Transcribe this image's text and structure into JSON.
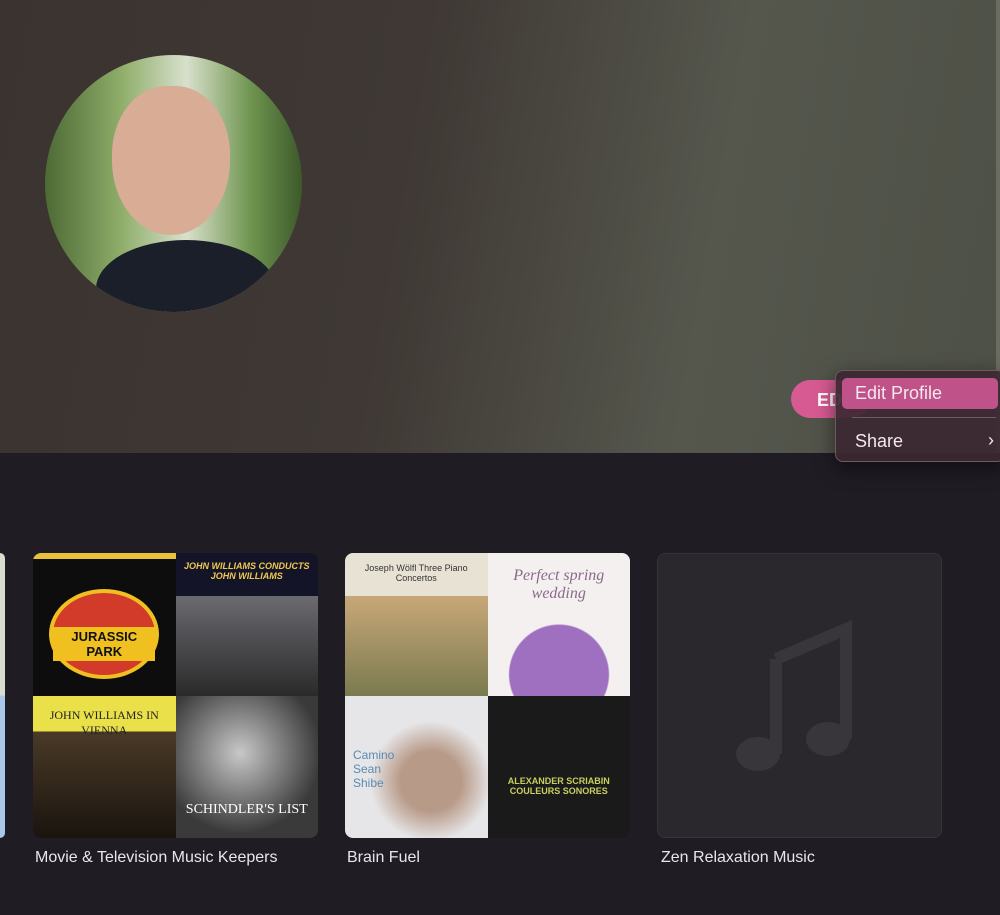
{
  "profile": {
    "edit_button_label": "EDIT"
  },
  "context_menu": {
    "items": [
      {
        "label": "Edit Profile"
      },
      {
        "label": "Share",
        "submenu_icon": "chevron-right"
      }
    ]
  },
  "playlists": [
    {
      "title": "Movie & Television Music Keepers",
      "covers": [
        "JURASSIC PARK",
        "JOHN WILLIAMS CONDUCTS JOHN WILLIAMS",
        "JOHN WILLIAMS IN VIENNA",
        "SCHINDLER'S LIST"
      ]
    },
    {
      "title": "Brain Fuel",
      "covers": [
        "Joseph Wölfl Three Piano Concertos",
        "Perfect spring wedding",
        "Camino Sean Shibe",
        "ALEXANDER SCRIABIN COULEURS SONORES"
      ]
    },
    {
      "title": "Zen Relaxation Music",
      "placeholder_icon": "music-note"
    }
  ]
}
